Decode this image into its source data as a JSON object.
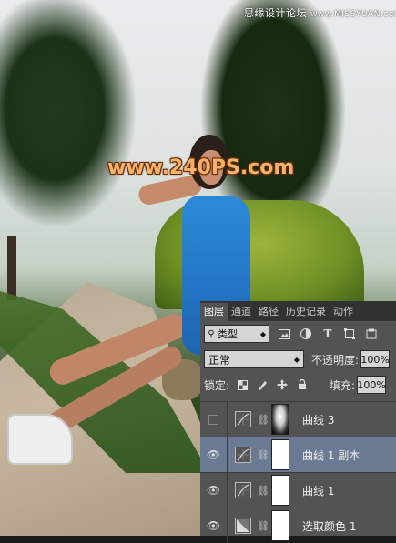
{
  "watermark": {
    "text": "思缘设计论坛",
    "site": "www.MISSYUAN.com"
  },
  "brand": "www.240PS.com",
  "panel": {
    "tabs": [
      {
        "label": "图层",
        "active": true
      },
      {
        "label": "通道",
        "active": false
      },
      {
        "label": "路径",
        "active": false
      },
      {
        "label": "历史记录",
        "active": false
      },
      {
        "label": "动作",
        "active": false
      }
    ],
    "filter": {
      "value": "类型",
      "icons": [
        "image-filter-icon",
        "adjustment-filter-icon",
        "text-filter-icon",
        "shape-filter-icon",
        "smart-object-filter-icon"
      ]
    },
    "blend_mode": "正常",
    "opacity": {
      "label": "不透明度:",
      "value": "100%"
    },
    "lock": {
      "label": "锁定:",
      "icons": [
        "lock-transparent-icon",
        "lock-image-icon",
        "lock-position-icon",
        "lock-all-icon"
      ]
    },
    "fill": {
      "label": "填充:",
      "value": "100%"
    },
    "layers": [
      {
        "name": "曲线 3",
        "visible": false,
        "selected": false,
        "mask": "dark",
        "type": "curves"
      },
      {
        "name": "曲线 1 副本",
        "visible": true,
        "selected": true,
        "mask": "white",
        "type": "curves"
      },
      {
        "name": "曲线 1",
        "visible": true,
        "selected": false,
        "mask": "white",
        "type": "curves"
      },
      {
        "name": "选取颜色 1",
        "visible": true,
        "selected": false,
        "mask": "white",
        "type": "selective-color"
      }
    ]
  }
}
